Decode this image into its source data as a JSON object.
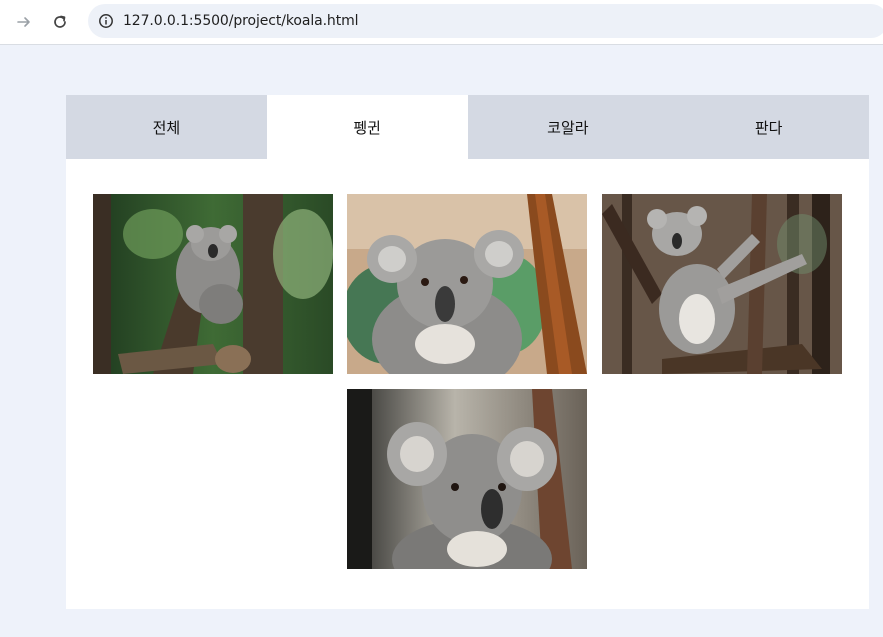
{
  "browser": {
    "url": "127.0.0.1:5500/project/koala.html",
    "forward_icon": "arrow-right-icon",
    "reload_icon": "reload-icon",
    "info_icon": "info-icon"
  },
  "tabs": [
    {
      "label": "전체",
      "active": false
    },
    {
      "label": "펭귄",
      "active": true
    },
    {
      "label": "코알라",
      "active": false
    },
    {
      "label": "판다",
      "active": false
    }
  ],
  "gallery": {
    "items": [
      {
        "subject": "koala-sleeping-on-tree"
      },
      {
        "subject": "koala-closeup-on-branch"
      },
      {
        "subject": "koala-reaching-branch"
      },
      {
        "subject": "koala-portrait"
      }
    ]
  },
  "colors": {
    "page_bg": "#eef2fa",
    "tab_bg": "#d4d9e3",
    "tab_active_bg": "#ffffff"
  }
}
